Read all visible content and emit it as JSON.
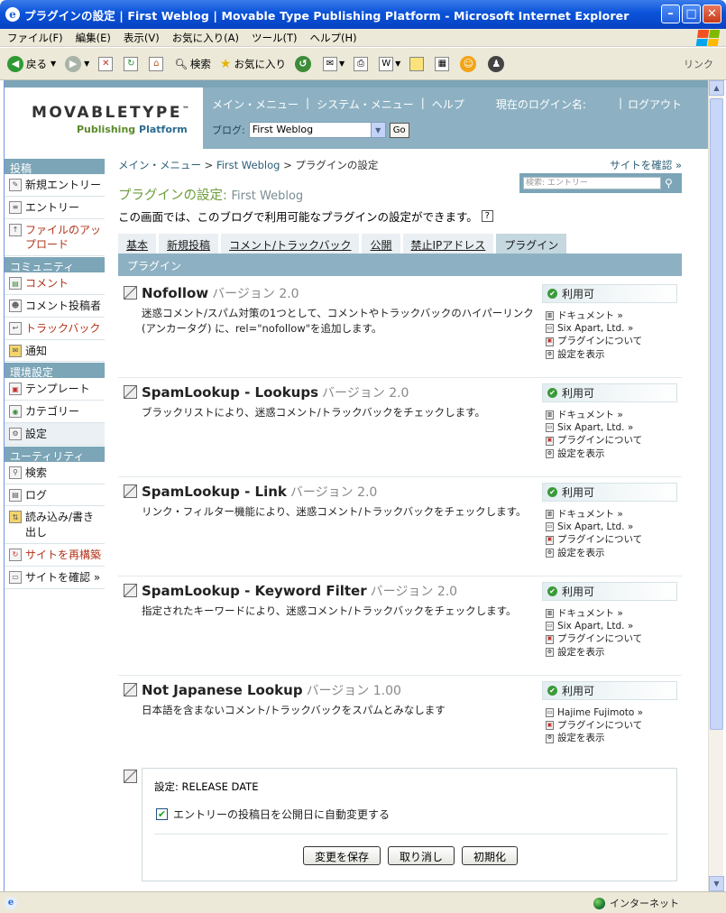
{
  "window": {
    "title": "プラグインの設定 | First Weblog | Movable Type Publishing Platform - Microsoft Internet Explorer"
  },
  "menubar": [
    "ファイル(F)",
    "編集(E)",
    "表示(V)",
    "お気に入り(A)",
    "ツール(T)",
    "ヘルプ(H)"
  ],
  "toolbar": {
    "back": "戻る",
    "search": "検索",
    "favorites": "お気に入り",
    "links": "リンク"
  },
  "status": {
    "zone": "インターネット"
  },
  "header": {
    "logo_main": "MOVABLETYPE",
    "logo_tm": "™",
    "logo_sub_a": "Publishing",
    "logo_sub_b": "Platform",
    "nav_main": "メイン・メニュー",
    "nav_system": "システム・メニュー",
    "nav_help": "ヘルプ",
    "login": "現在のログイン名:",
    "logout": "ログアウト",
    "blog_label": "ブログ:",
    "blog_value": "First Weblog",
    "go": "Go"
  },
  "sidebar": {
    "sections": [
      {
        "title": "投稿",
        "items": [
          "新規エントリー",
          "エントリー",
          "ファイルのアップロード"
        ]
      },
      {
        "title": "コミュニティ",
        "items": [
          "コメント",
          "コメント投稿者",
          "トラックバック",
          "通知"
        ]
      },
      {
        "title": "環境設定",
        "items": [
          "テンプレート",
          "カテゴリー",
          "設定"
        ]
      },
      {
        "title": "ユーティリティ",
        "items": [
          "検索",
          "ログ",
          "読み込み/書き出し",
          "サイトを再構築",
          "サイトを確認 »"
        ]
      }
    ]
  },
  "main": {
    "crumb_1": "メイン・メニュー",
    "crumb_2": "First Weblog",
    "crumb_3": "プラグインの設定",
    "crumb_sep": " > ",
    "view_site": "サイトを確認 »",
    "search_placeholder": "検索: エントリー",
    "title": "プラグインの設定:",
    "title_blog": "First Weblog",
    "description": "この画面では、このブログで利用可能なプラグインの設定ができます。",
    "help": "?",
    "tabs": [
      "基本",
      "新規投稿",
      "コメント/トラックバック",
      "公開",
      "禁止IPアドレス",
      "プラグイン"
    ],
    "section": "プラグイン",
    "version_label": "バージョン",
    "status_available": "利用可",
    "plugins": [
      {
        "name": "Nofollow",
        "version": "2.0",
        "description": "迷惑コメント/スパム対策の1つとして、コメントやトラックバックのハイパーリンク (アンカータグ) に、rel=\"nofollow\"を追加します。",
        "links": [
          "ドキュメント »",
          "Six Apart, Ltd. »",
          "プラグインについて",
          "設定を表示"
        ]
      },
      {
        "name": "SpamLookup - Lookups",
        "version": "2.0",
        "description": "ブラックリストにより、迷惑コメント/トラックバックをチェックします。",
        "links": [
          "ドキュメント »",
          "Six Apart, Ltd. »",
          "プラグインについて",
          "設定を表示"
        ]
      },
      {
        "name": "SpamLookup - Link",
        "version": "2.0",
        "description": "リンク・フィルター機能により、迷惑コメント/トラックバックをチェックします。",
        "links": [
          "ドキュメント »",
          "Six Apart, Ltd. »",
          "プラグインについて",
          "設定を表示"
        ]
      },
      {
        "name": "SpamLookup - Keyword Filter",
        "version": "2.0",
        "description": "指定されたキーワードにより、迷惑コメント/トラックバックをチェックします。",
        "links": [
          "ドキュメント »",
          "Six Apart, Ltd. »",
          "プラグインについて",
          "設定を表示"
        ]
      },
      {
        "name": "Not Japanese Lookup",
        "version": "1.00",
        "description": "日本語を含まないコメント/トラックバックをスパムとみなします",
        "links": [
          "Hajime Fujimoto »",
          "プラグインについて",
          "設定を表示"
        ]
      }
    ],
    "settings": {
      "title": "設定: RELEASE DATE",
      "checkbox_label": "エントリーの投稿日を公開日に自動変更する",
      "checkbox_checked": true,
      "save": "変更を保存",
      "cancel": "取り消し",
      "reset": "初期化"
    }
  }
}
